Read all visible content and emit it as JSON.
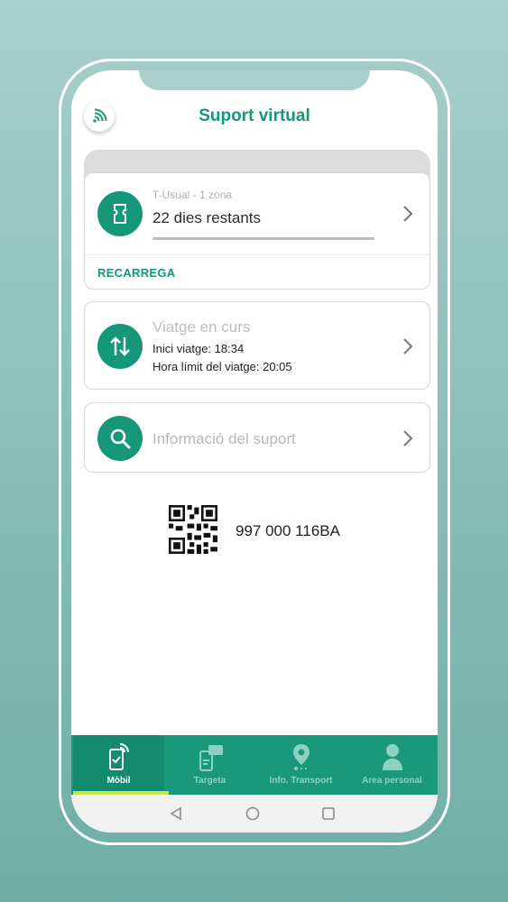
{
  "header": {
    "title": "Suport virtual",
    "nfc_icon": "nfc-signal-icon"
  },
  "ticket_card": {
    "ticket_type": "T-Usual - 1 zona",
    "remaining": "22 dies restants",
    "remaining_fraction": 0.95,
    "recharge_label": "RECARREGA",
    "icon": "ticket-icon"
  },
  "trip_card": {
    "title": "Viatge en curs",
    "start_line": "Inici viatge: 18:34",
    "limit_line": "Hora límit del viatge: 20:05",
    "icon": "up-down-arrows-icon"
  },
  "info_card": {
    "title": "Informació del suport",
    "icon": "search-icon"
  },
  "support": {
    "number": "997 000 116BA",
    "qr_icon": "qr-code-icon"
  },
  "bottom_nav": {
    "items": [
      {
        "label": "Mòbil",
        "icon": "mobile-nfc-icon",
        "active": true
      },
      {
        "label": "Targeta",
        "icon": "card-phone-icon",
        "active": false
      },
      {
        "label": "Info. Transport",
        "icon": "location-pin-icon",
        "active": false
      },
      {
        "label": "Area personal",
        "icon": "person-icon",
        "active": false
      }
    ]
  },
  "colors": {
    "accent": "#15977a",
    "nav_bg": "#19987b",
    "active_indicator": "#c7e34a",
    "background": "#8cc0b8"
  }
}
